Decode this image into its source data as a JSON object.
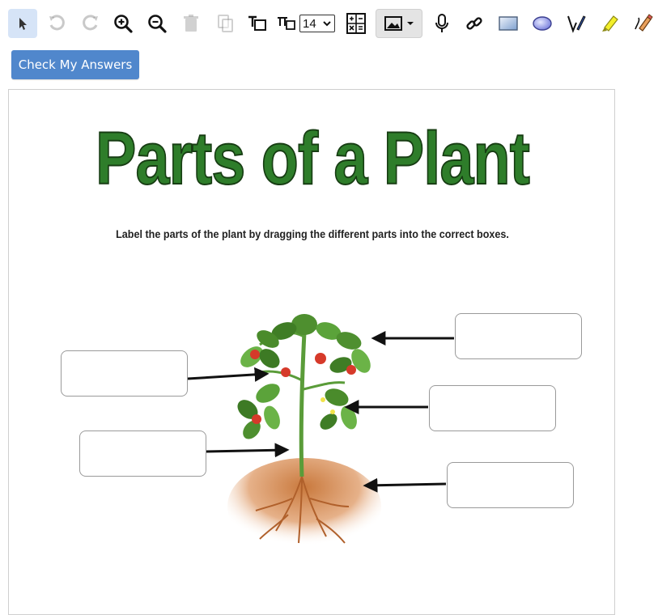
{
  "toolbar": {
    "tools": [
      {
        "name": "select",
        "icon": "cursor-arrow"
      },
      {
        "name": "undo",
        "icon": "undo-arrow"
      },
      {
        "name": "redo",
        "icon": "redo-arrow"
      },
      {
        "name": "zoom-in",
        "icon": "magnifier-plus"
      },
      {
        "name": "zoom-out",
        "icon": "magnifier-minus"
      },
      {
        "name": "delete",
        "icon": "trash-can"
      },
      {
        "name": "duplicate",
        "icon": "copy-pages"
      },
      {
        "name": "text",
        "icon": "text-box"
      },
      {
        "name": "text-size",
        "icon": "text-size"
      },
      {
        "name": "math",
        "icon": "math-symbols"
      },
      {
        "name": "image",
        "icon": "image"
      },
      {
        "name": "record",
        "icon": "microphone"
      },
      {
        "name": "link",
        "icon": "chain-link"
      },
      {
        "name": "rectangle",
        "icon": "rectangle-shape"
      },
      {
        "name": "ellipse",
        "icon": "ellipse-shape"
      },
      {
        "name": "pen",
        "icon": "pen"
      },
      {
        "name": "highlighter",
        "icon": "highlighter"
      },
      {
        "name": "eraser",
        "icon": "pencil-eraser"
      }
    ],
    "font_size": "14"
  },
  "check_button": {
    "label": "Check My Answers"
  },
  "worksheet": {
    "title": "Parts of a Plant",
    "instructions": "Label the parts of the plant by dragging the different parts into the correct boxes.",
    "label_boxes": [
      {
        "side": "left",
        "value": "",
        "points_to": "leaf"
      },
      {
        "side": "left",
        "value": "",
        "points_to": "stem"
      },
      {
        "side": "right",
        "value": "",
        "points_to": "top leaves"
      },
      {
        "side": "right",
        "value": "",
        "points_to": "flower"
      },
      {
        "side": "right",
        "value": "",
        "points_to": "roots"
      }
    ]
  },
  "colors": {
    "accent": "#5087cc",
    "title_green": "#2e7d2a",
    "active_tool_bg": "#d6e4f7"
  }
}
